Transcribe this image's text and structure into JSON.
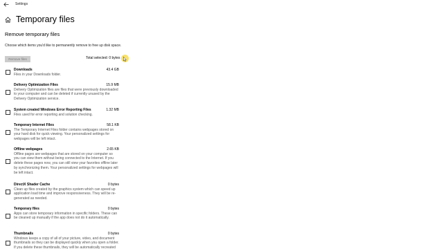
{
  "app": {
    "window_title": "Settings"
  },
  "header": {
    "page_title": "Temporary files"
  },
  "section": {
    "title": "Remove temporary files",
    "description": "Choose which items you'd like to permanently remove to free up disk space.",
    "remove_button_label": "Remove files",
    "total_selected": "Total selected: 0 bytes"
  },
  "items": [
    {
      "name": "Downloads",
      "size": "43.4 GB",
      "desc": "Files in your Downloads folder.",
      "checked": false
    },
    {
      "name": "Delivery Optimization Files",
      "size": "15.9 MB",
      "desc": "Delivery Optimization files are files that were previously downloaded to your computer and can be deleted if currently unused by the Delivery Optimization service.",
      "checked": false
    },
    {
      "name": "System created Windows Error Reporting Files",
      "size": "1.32 MB",
      "desc": "Files used for error reporting and solution checking.",
      "checked": false
    },
    {
      "name": "Temporary Internet Files",
      "size": "58.1 KB",
      "desc": "The Temporary Internet Files folder contains webpages stored on your hard disk for quick viewing. Your personalized settings for webpages will be left intact.",
      "checked": false
    },
    {
      "name": "Offline webpages",
      "size": "2.65 KB",
      "desc": "Offline pages are webpages that are stored on your computer so you can view them without being connected to the Internet. If you delete these pages now, you can still view your favorites offline later by synchronizing them. Your personalized settings for webpages will be left intact.",
      "checked": false
    },
    {
      "name": "DirectX Shader Cache",
      "size": "0 bytes",
      "desc": "Clean up files created by the graphics system which can speed up application load time and improve responsiveness. They will be re-generated as needed.",
      "checked": false
    },
    {
      "name": "Temporary files",
      "size": "0 bytes",
      "desc": "Apps can store temporary information in specific folders. These can be cleaned up manually if the app does not do it automatically.",
      "checked": false
    },
    {
      "name": "Thumbnails",
      "size": "0 bytes",
      "desc": "Windows keeps a copy of all of your picture, video, and document thumbnails so they can be displayed quickly when you open a folder. If you delete these thumbnails, they will be automatically recreated as needed.",
      "checked": false
    }
  ],
  "icons": {
    "back": "back-arrow-icon",
    "home": "home-icon",
    "cursor": "mouse-pointer-icon"
  },
  "colors": {
    "background": "#ffffff",
    "button_disabled_bg": "#cccccc",
    "button_disabled_text": "#7a7a7a",
    "desc_text": "#555555",
    "cursor_highlight": "#f5d73c"
  }
}
